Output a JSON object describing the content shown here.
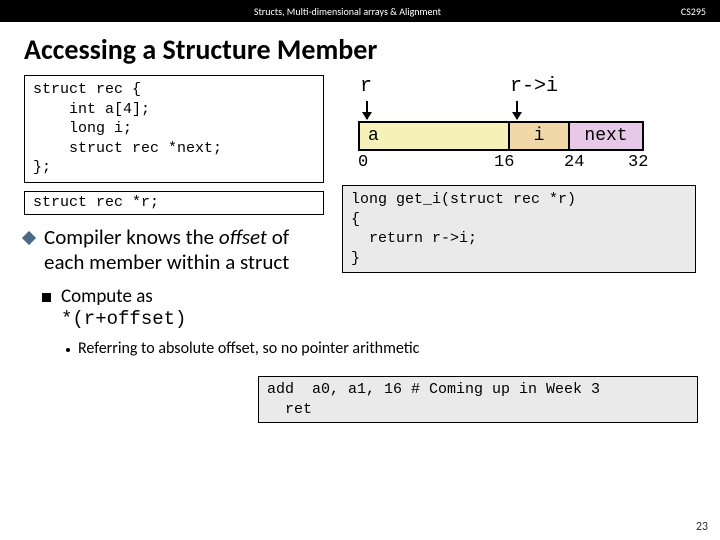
{
  "topbar": {
    "title": "Structs, Multi-dimensional arrays & Alignment",
    "right": "CS295"
  },
  "slide_title": "Accessing a Structure Member",
  "struct_code": "struct rec {\n    int a[4];\n    long i;\n    struct rec *next;\n};",
  "decl_code": "struct rec *r;",
  "bullet1_pre": "Compiler knows the ",
  "bullet1_em": "offset",
  "bullet1_post": " of each member within a struct",
  "sub1_pre": "Compute as ",
  "sub1_code": "*(r+offset)",
  "sub2_text": "Referring to absolute offset, so no pointer arithmetic",
  "diagram": {
    "ptr_r": "r",
    "ptr_ri": "r->i",
    "cell_a": "a",
    "cell_i": "i",
    "cell_next": "next",
    "off0": "0",
    "off16": "16",
    "off24": "24",
    "off32": "32"
  },
  "func_code": "long get_i(struct rec *r)\n{\n  return r->i;\n}",
  "asm_code": "add  a0, a1, 16 # Coming up in Week 3\n  ret",
  "page_num": "23"
}
